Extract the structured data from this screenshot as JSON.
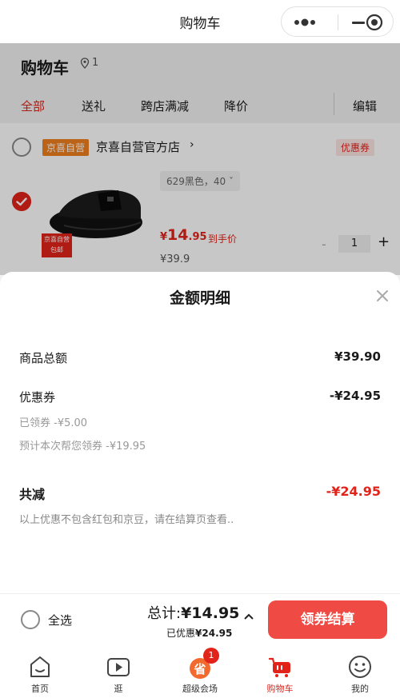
{
  "topbar": {
    "title": "购物车"
  },
  "background": {
    "title": "购物车",
    "location_count": "1",
    "tabs": [
      "全部",
      "送礼",
      "跨店满减",
      "降价"
    ],
    "edit_label": "编辑",
    "store": {
      "badge": "京喜自营",
      "name": "京喜自营官方店",
      "arrow": "›",
      "coupon_tag": "优惠券"
    },
    "product": {
      "image_badge_line1": "京喜自营",
      "image_badge_line2": "包邮",
      "sku": "629黑色，40  ˇ",
      "price_symbol": "¥",
      "price_int": "14",
      "price_dec": ".95",
      "price_label": "到手价",
      "original_price": "¥39.9",
      "minus": "-",
      "quantity": "1",
      "plus": "+"
    }
  },
  "sheet": {
    "title": "金额明细",
    "goods_total_label": "商品总额",
    "goods_total_value": "¥39.90",
    "coupon_label": "优惠券",
    "coupon_value": "-¥24.95",
    "claimed_coupon": "已领券 -¥5.00",
    "estimated_coupon": "预计本次帮您领券 -¥19.95",
    "total_reduce_label": "共减",
    "total_reduce_value": "-¥24.95",
    "note": "以上优惠不包含红包和京豆，请在结算页查看.."
  },
  "actionbar": {
    "select_all": "全选",
    "total_label": "总计:",
    "total_value": "¥14.95",
    "saved_label": "已优惠",
    "saved_value": "¥24.95",
    "checkout": "领券结算"
  },
  "tabbar": {
    "items": [
      {
        "label": "首页",
        "icon": "home-icon"
      },
      {
        "label": "逛",
        "icon": "video-play-icon"
      },
      {
        "label": "超级会场",
        "icon": "super-venue-icon",
        "badge": "1"
      },
      {
        "label": "购物车",
        "icon": "cart-icon"
      },
      {
        "label": "我的",
        "icon": "smiley-icon"
      }
    ],
    "active": "购物车"
  },
  "colors": {
    "accent": "#e2231a",
    "button": "#ef4a43",
    "store_badge": "#f07f1e"
  }
}
